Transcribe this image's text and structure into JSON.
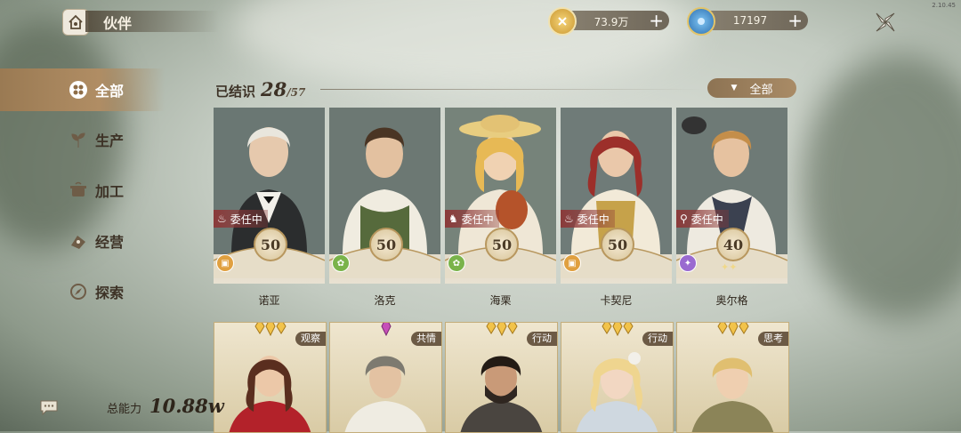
{
  "version": "2.10.45",
  "header": {
    "title": "伙伴"
  },
  "resources": [
    {
      "icon": "coin-icon",
      "value": "73.9万",
      "color": "#e0b64a"
    },
    {
      "icon": "gem-icon",
      "value": "17197",
      "color": "#3b86c8"
    }
  ],
  "sidebar": {
    "items": [
      {
        "label": "全部",
        "icon": "clover-icon",
        "active": true
      },
      {
        "label": "生产",
        "icon": "sprout-icon",
        "active": false
      },
      {
        "label": "加工",
        "icon": "pot-icon",
        "active": false
      },
      {
        "label": "经营",
        "icon": "coins-icon",
        "active": false
      },
      {
        "label": "探索",
        "icon": "compass-icon",
        "active": false
      }
    ]
  },
  "known": {
    "label": "已结识",
    "count": "28",
    "total": "/57"
  },
  "filter": {
    "label": "全部"
  },
  "companions": [
    {
      "name": "诺亚",
      "status": "委任中",
      "level": "50",
      "type_icon": "pot-icon",
      "type_color": "#e0a040"
    },
    {
      "name": "洛克",
      "status": "",
      "level": "50",
      "type_icon": "sprout-icon",
      "type_color": "#7ab34a"
    },
    {
      "name": "海栗",
      "status": "委任中",
      "level": "50",
      "type_icon": "sprout-icon",
      "type_color": "#7ab34a"
    },
    {
      "name": "卡契尼",
      "status": "委任中",
      "level": "50",
      "type_icon": "pot-icon",
      "type_color": "#e0a040"
    },
    {
      "name": "奥尔格",
      "status": "委任中",
      "level": "40",
      "type_icon": "compass-icon",
      "type_color": "#9a6ad0",
      "stars": "✦✦"
    }
  ],
  "recruits": [
    {
      "tag": "观察"
    },
    {
      "tag": "共情"
    },
    {
      "tag": "行动"
    },
    {
      "tag": "行动"
    },
    {
      "tag": "思考"
    }
  ],
  "power": {
    "label": "总能力",
    "value": "10.88w"
  }
}
